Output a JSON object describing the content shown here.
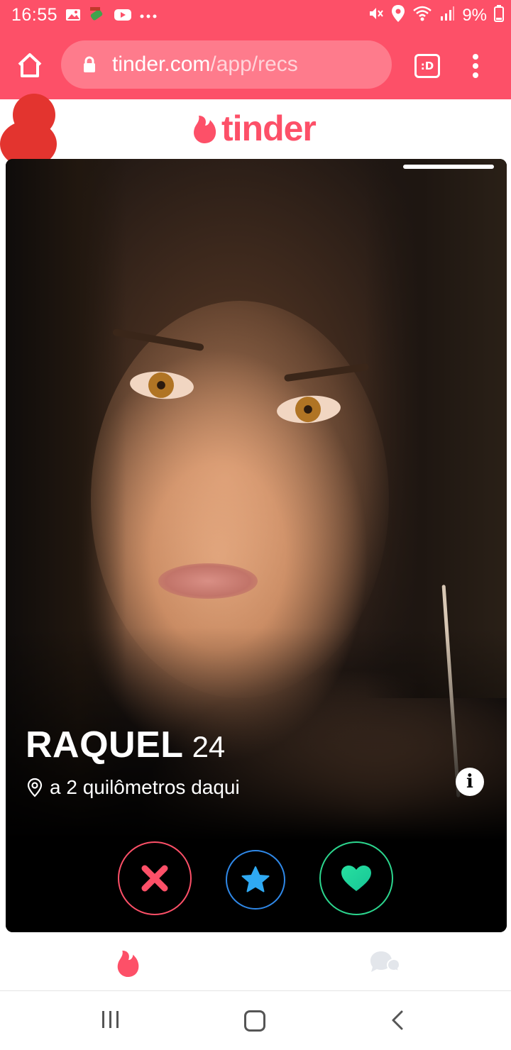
{
  "status_bar": {
    "time": "16:55",
    "battery": "9%",
    "left_icons": [
      "image-icon",
      "fake-gps-icon",
      "youtube-icon",
      "more-dots-icon"
    ],
    "right_icons": [
      "mute-icon",
      "location-icon",
      "wifi-icon",
      "signal-icon",
      "battery-icon"
    ]
  },
  "browser": {
    "url_host": "tinder.com",
    "url_path": "/app/recs",
    "tab_label": ":D"
  },
  "header": {
    "logo_text": "tinder",
    "brand_color": "#fd5068"
  },
  "profile": {
    "name": "RAQUEL",
    "age": "24",
    "distance": "a 2 quilômetros daqui",
    "photo_count": 1
  },
  "actions": {
    "nope_color": "#fd5068",
    "super_like_color": "#2f88e8",
    "like_color": "#2cd68e"
  },
  "bottom_nav": {
    "items": [
      "flame-icon",
      "chat-bubbles-icon"
    ]
  }
}
